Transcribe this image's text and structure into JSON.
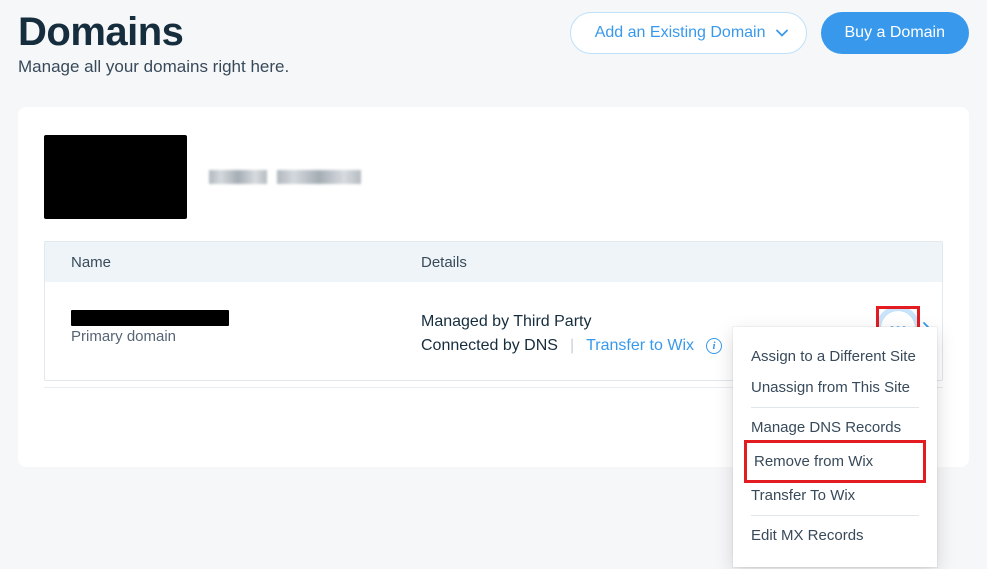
{
  "header": {
    "title": "Domains",
    "subtitle": "Manage all your domains right here.",
    "add_existing": "Add an Existing Domain",
    "buy": "Buy a Domain"
  },
  "table": {
    "col_name": "Name",
    "col_details": "Details"
  },
  "row": {
    "domain_name": "",
    "primary_label": "Primary domain",
    "managed_by": "Managed by Third Party",
    "connected_by": "Connected by DNS",
    "transfer_link": "Transfer to Wix"
  },
  "menu": {
    "assign": "Assign to a Different Site",
    "unassign": "Unassign from This Site",
    "manage_dns": "Manage DNS Records",
    "remove": "Remove from Wix",
    "transfer": "Transfer To Wix",
    "edit_mx": "Edit MX Records"
  }
}
